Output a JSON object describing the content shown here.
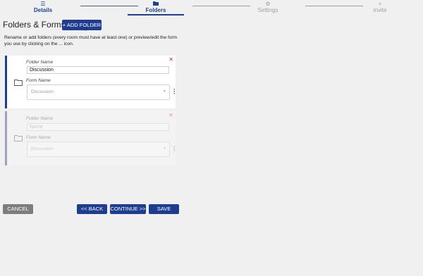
{
  "stepper": {
    "steps": [
      {
        "label": "Details",
        "icon": "list-icon",
        "state": "done"
      },
      {
        "label": "Folders",
        "icon": "folder-icon",
        "state": "active"
      },
      {
        "label": "Settings",
        "icon": "gear-icon",
        "state": "inactive"
      },
      {
        "label": "Invite",
        "icon": "plus-icon",
        "state": "inactive"
      }
    ]
  },
  "header": {
    "title": "Folders & Forms",
    "add_folder_label": "+ ADD FOLDER"
  },
  "description": "Rename or add folders (every room must have at least one) or preview/edit the form you use by clicking on the ... icon.",
  "folders": [
    {
      "folder_name_label": "Folder Name",
      "folder_name_value": "Discussion",
      "form_name_label": "Form Name",
      "form_name_value": "Discussion",
      "state": "active"
    },
    {
      "folder_name_label": "Folder Name",
      "folder_name_placeholder": "Name",
      "form_name_label": "Form Name",
      "form_name_value": "Discussion",
      "state": "disabled"
    }
  ],
  "footer": {
    "cancel_label": "CANCEL",
    "back_label": "<< BACK",
    "continue_label": "CONTINUE >>",
    "save_label": "SAVE"
  },
  "colors": {
    "primary": "#1e3d91",
    "delete": "#c62828",
    "cancel": "#7d7d7d",
    "background": "#f0f0f0"
  }
}
